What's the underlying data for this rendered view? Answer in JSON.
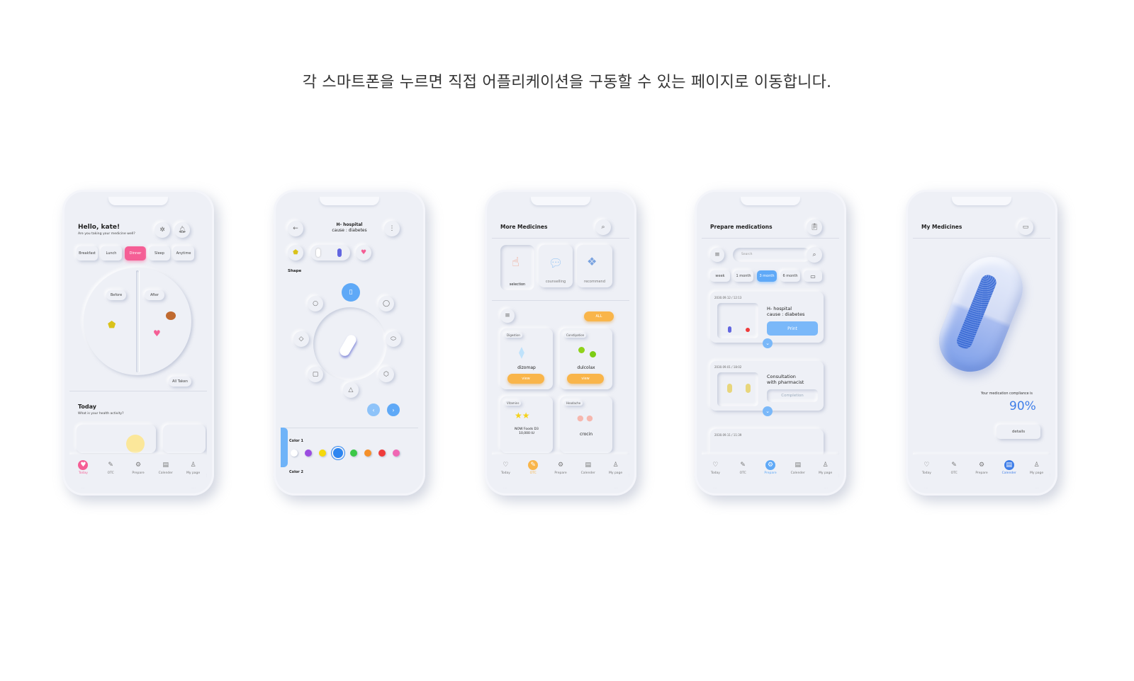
{
  "headline": "각 스마트폰을 누르면 직접 어플리케이션을 구동할 수 있는 페이지로 이동합니다.",
  "colors": {
    "pink": "#f55e95",
    "orange": "#f9b54a",
    "blue": "#5fa9f7",
    "bg": "#eef0f6"
  },
  "nav": [
    "Today",
    "OTC",
    "Prepare",
    "Calender",
    "My page"
  ],
  "phone1": {
    "greeting": "Hello, kate!",
    "subtitle": "Are you taking your medicine well?",
    "meals": [
      "Breakfast",
      "Lunch",
      "Dinner",
      "Sleep",
      "Anytime"
    ],
    "selected_meal": "Dinner",
    "before": "Before",
    "after": "After",
    "all_taken": "All Taken",
    "today_title": "Today",
    "today_sub": "What is your health activity?"
  },
  "phone2": {
    "title_line1": "H- hospital",
    "title_line2": "cause : diabetes",
    "shape_label": "Shape",
    "color1": "Color 1",
    "color2": "Color 2",
    "color_swatches": [
      "#ffffff",
      "#9b4de0",
      "#f5d90a",
      "#2e86f0",
      "#3cc848",
      "#f5902a",
      "#ef3b3b",
      "#f067b4"
    ]
  },
  "phone3": {
    "title": "More Medicines",
    "categories": [
      "selection",
      "counselling",
      "recommend"
    ],
    "filter_all": "ALL",
    "medicines": [
      {
        "tag": "Digestion",
        "name": "dizomap",
        "button": "view"
      },
      {
        "tag": "Constipation",
        "name": "dulcolax",
        "button": "view"
      },
      {
        "tag": "Vitamins",
        "name": "NOW Foods D3\n10,000 IU",
        "button": ""
      },
      {
        "tag": "Headache",
        "name": "crocin",
        "button": ""
      }
    ]
  },
  "phone4": {
    "title": "Prepare medications",
    "search_placeholder": "Search",
    "periods": [
      "week",
      "1 month",
      "3 month",
      "6 month"
    ],
    "selected_period": "3 month",
    "records": [
      {
        "date": "2030.09.12 / 12:13",
        "title": "H- hospital\ncause : diabetes",
        "action": "Print"
      },
      {
        "date": "2030.09.01 / 18:02",
        "title": "Consultation\nwith pharmacist",
        "action": "Completion"
      },
      {
        "date": "2030.09.11 / 11:39",
        "title": "",
        "action": ""
      }
    ]
  },
  "phone5": {
    "title": "My Medicines",
    "compliance_label": "Your medication compliance is",
    "compliance_value": "90%",
    "details": "details"
  }
}
